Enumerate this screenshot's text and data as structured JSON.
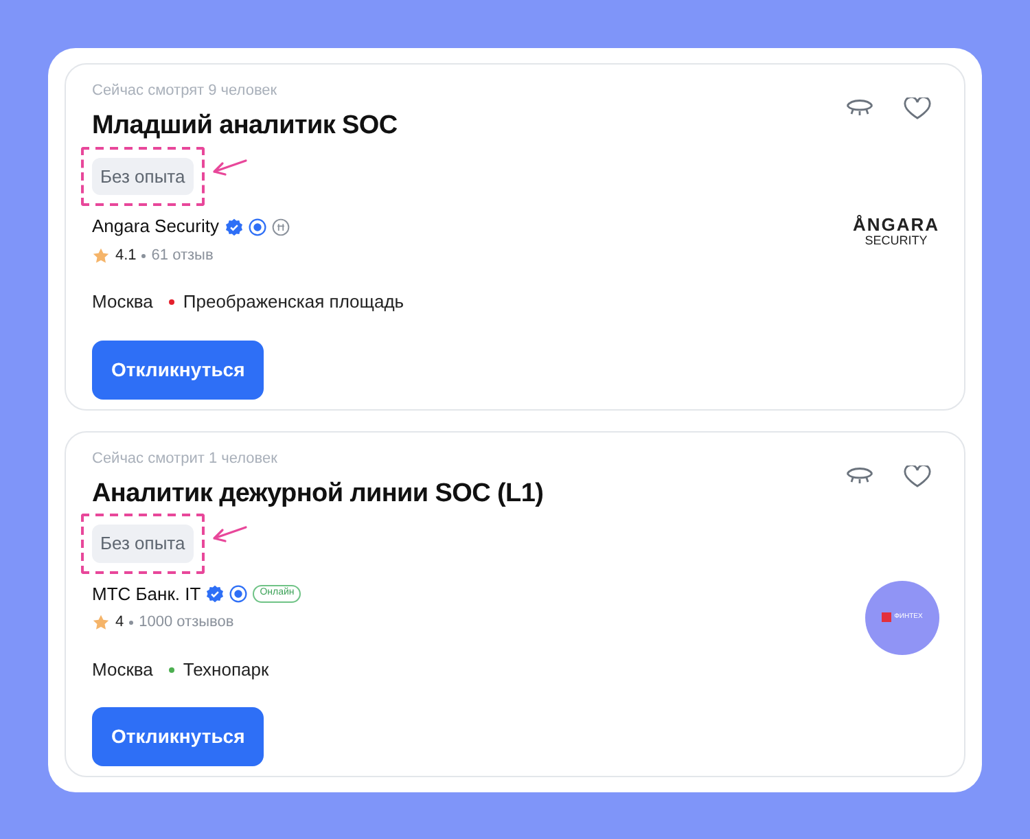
{
  "vacancies": [
    {
      "viewers": "Сейчас смотрят 9 человек",
      "title": "Младший аналитик SOC",
      "tag": {
        "label": "Без опыта",
        "highlighted": true
      },
      "company": "Angara Security",
      "badges": [
        {
          "kind": "verified"
        },
        {
          "kind": "accredited"
        },
        {
          "kind": "rank"
        }
      ],
      "rating": "4.1",
      "reviews": "61 отзыв",
      "city": "Москва",
      "metro": {
        "name": "Преображенская площадь",
        "color": "#e4202c"
      },
      "logo": {
        "kind": "angara",
        "lines": [
          "ÅNGARA",
          "SECURITY"
        ]
      },
      "button": "Откликнуться"
    },
    {
      "viewers": "Сейчас смотрит 1 человек",
      "title": "Аналитик дежурной линии SOC (L1)",
      "tag": {
        "label": "Без опыта",
        "highlighted": true
      },
      "company": "МТС Банк. IT",
      "badges": [
        {
          "kind": "verified"
        },
        {
          "kind": "accredited"
        },
        {
          "kind": "text",
          "label": "Онлайн"
        }
      ],
      "rating": "4",
      "reviews": "1000 отзывов",
      "city": "Москва",
      "metro": {
        "name": "Технопарк",
        "color": "#4caf50"
      },
      "logo": {
        "kind": "circle",
        "lines": [
          "ФИНТЕХ"
        ]
      },
      "button": "Откликнуться"
    }
  ]
}
